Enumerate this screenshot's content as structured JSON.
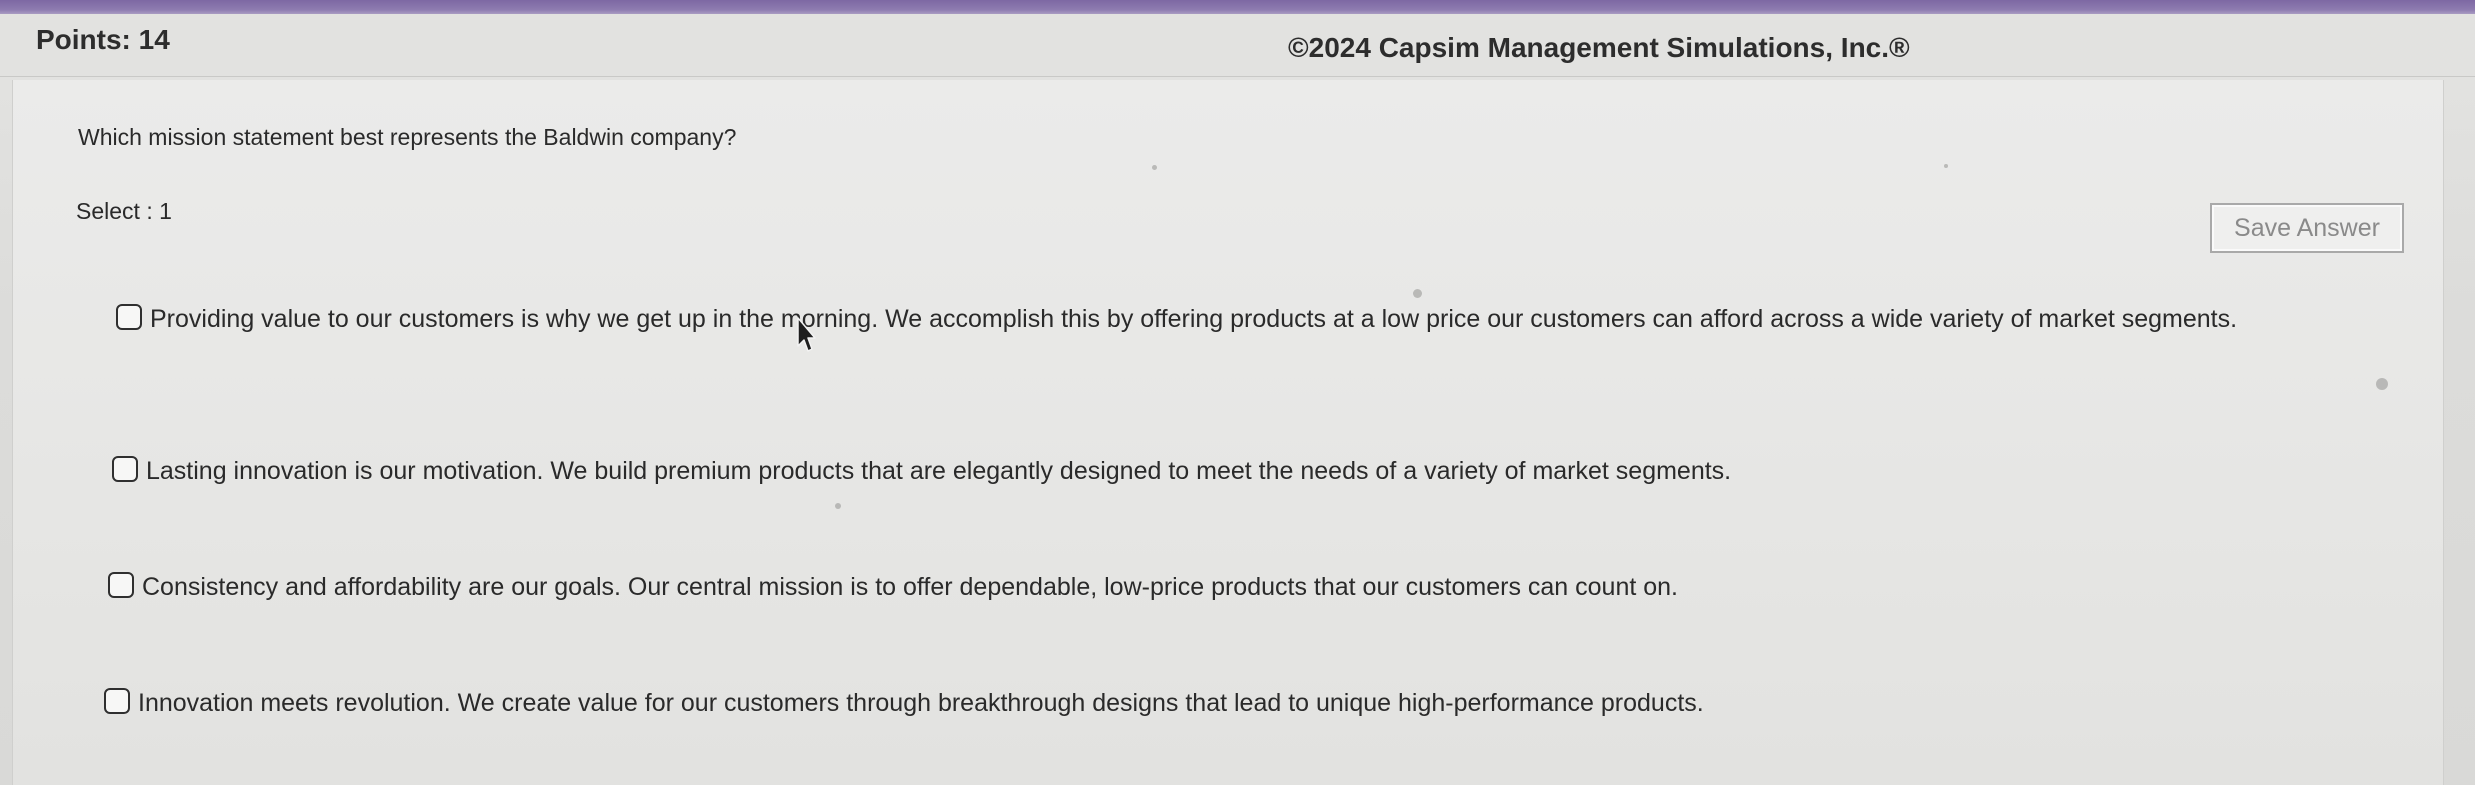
{
  "header": {
    "points": "Points: 14",
    "copyright": "©2024 Capsim Management Simulations, Inc.®"
  },
  "question": {
    "text": "Which mission statement best represents the Baldwin company?",
    "select_label": "Select : 1"
  },
  "actions": {
    "save_label": "Save Answer"
  },
  "options": [
    {
      "text": "Providing value to our customers is why we get up in the morning. We accomplish this by offering products at a low price our customers can afford across a wide variety of market segments.",
      "checked": false
    },
    {
      "text": "Lasting innovation is our motivation. We build premium products that are elegantly designed to meet the needs of a variety of market segments.",
      "checked": false
    },
    {
      "text": "Consistency and affordability are our goals. Our central mission is to offer dependable, low-price products that our customers can count on.",
      "checked": false
    },
    {
      "text": "Innovation meets revolution. We create value for our customers through breakthrough designs that lead to unique high-performance products.",
      "checked": false
    }
  ],
  "colors": {
    "accent_strip": "#7d68a3",
    "text": "#2a2a2a",
    "button_text": "#8a8a8a"
  },
  "icons": {
    "cursor": "mouse-pointer-icon",
    "checkbox": "empty-checkbox-icon"
  }
}
